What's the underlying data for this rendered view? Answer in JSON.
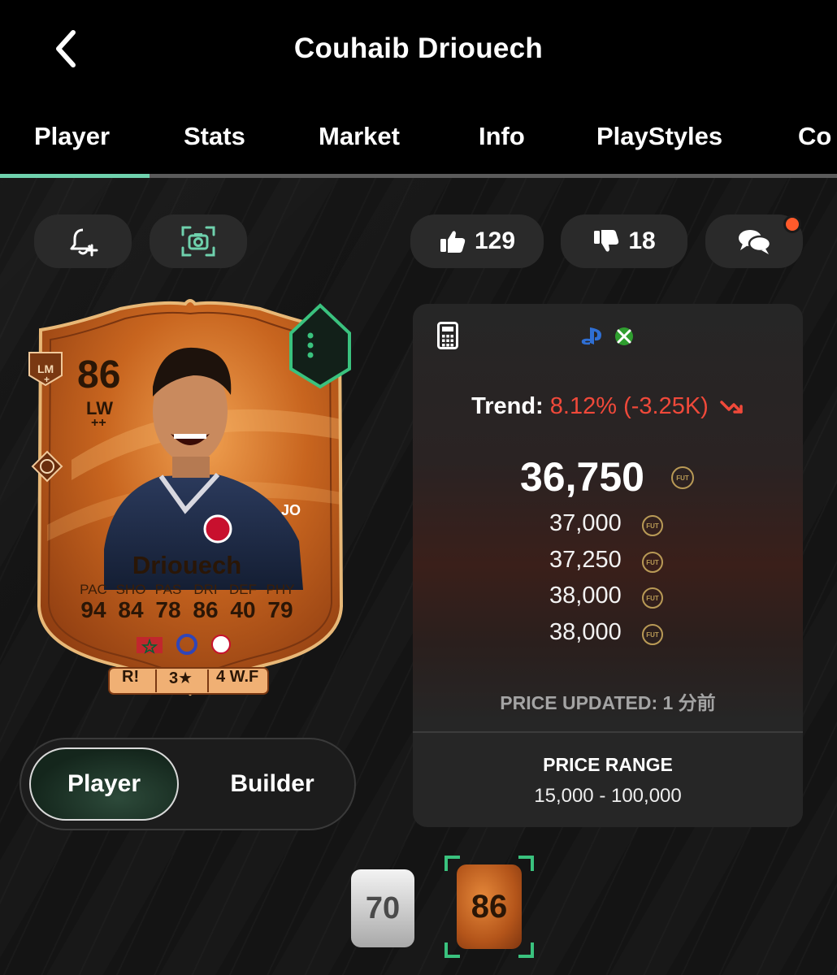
{
  "header": {
    "title": "Couhaib Driouech"
  },
  "tabs": [
    {
      "label": "Player",
      "active": true
    },
    {
      "label": "Stats"
    },
    {
      "label": "Market"
    },
    {
      "label": "Info"
    },
    {
      "label": "PlayStyles"
    },
    {
      "label": "Co"
    }
  ],
  "actions": {
    "likes": "129",
    "dislikes": "18"
  },
  "card": {
    "rating": "86",
    "position": "LW",
    "position_plus": "++",
    "alt_position": "LM",
    "alt_position_plus": "+",
    "name": "Driouech",
    "stats": [
      {
        "label": "PAC",
        "value": "94"
      },
      {
        "label": "SHO",
        "value": "84"
      },
      {
        "label": "PAS",
        "value": "78"
      },
      {
        "label": "DRI",
        "value": "86"
      },
      {
        "label": "DEF",
        "value": "40"
      },
      {
        "label": "PHY",
        "value": "79"
      }
    ],
    "badges": {
      "work_rate": "R!",
      "skill_moves": "3★",
      "weak_foot": "4 W.F"
    }
  },
  "view_toggle": {
    "player_label": "Player",
    "builder_label": "Builder",
    "active": "Player"
  },
  "price": {
    "trend_label": "Trend:",
    "trend_value": "8.12% (-3.25K)",
    "current": "36,750",
    "listings": [
      "37,000",
      "37,250",
      "38,000",
      "38,000"
    ],
    "updated_label": "PRICE UPDATED: 1 分前",
    "range_label": "PRICE RANGE",
    "range_value": "15,000 - 100,000",
    "coin_label": "FUT"
  },
  "versions": [
    {
      "rating": "70",
      "type": "silver"
    },
    {
      "rating": "86",
      "type": "special",
      "selected": true
    }
  ],
  "colors": {
    "accent": "#6fd1ad",
    "trend_down": "#f0493a",
    "notification": "#ff5a2b",
    "card_orange": "#c8651f"
  }
}
